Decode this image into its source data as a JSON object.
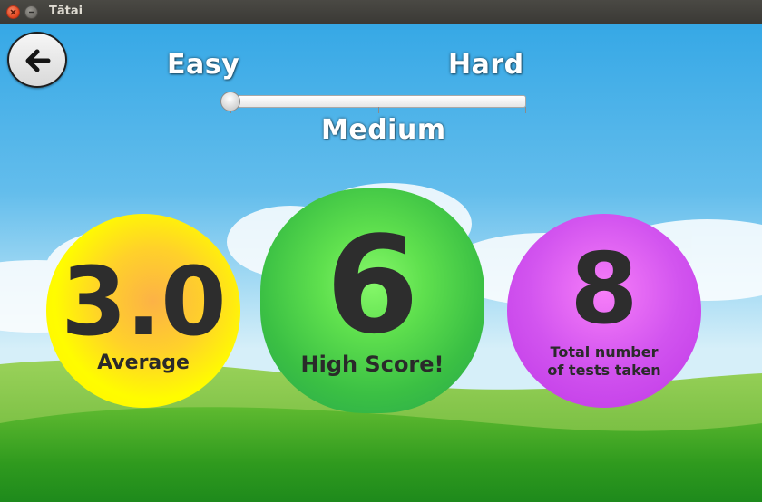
{
  "window": {
    "title": "Tātai"
  },
  "difficulty": {
    "labels": {
      "easy": "Easy",
      "medium": "Medium",
      "hard": "Hard"
    },
    "slider_value": 0
  },
  "stats": {
    "average": {
      "value": "3.0",
      "label": "Average",
      "color": "#fff200"
    },
    "high_score": {
      "value": "6",
      "label": "High Score!",
      "color": "#3bc044"
    },
    "tests_taken": {
      "value": "8",
      "label_line1": "Total number",
      "label_line2": "of tests taken",
      "color": "#be37e6"
    }
  },
  "icons": {
    "back": "back-arrow-icon",
    "close": "close-icon",
    "minimize": "minimize-icon"
  }
}
